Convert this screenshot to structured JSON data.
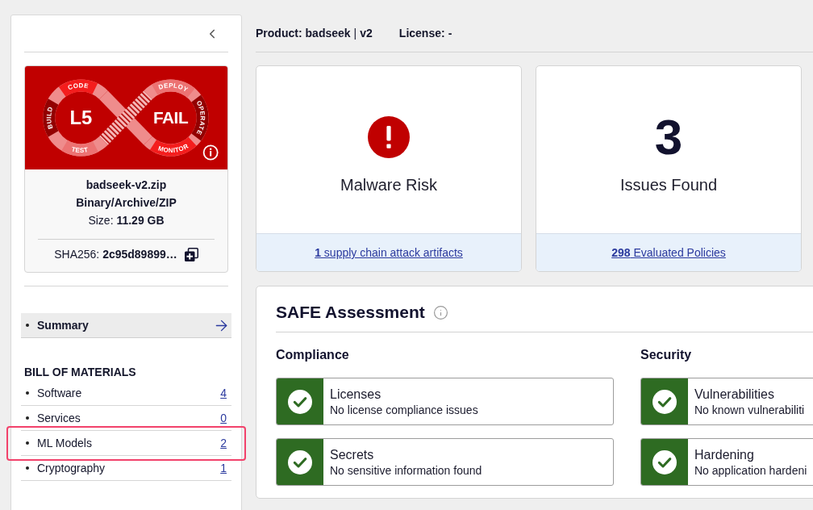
{
  "sidebar": {
    "badge": {
      "grade": "L5",
      "result": "FAIL",
      "stages": [
        {
          "label": "CODE",
          "color": "#f41d1d"
        },
        {
          "label": "DEPLOY",
          "color": "#ec7373"
        },
        {
          "label": "BUILD",
          "color": "#930000"
        },
        {
          "label": "OPERATE",
          "color": "#930000"
        },
        {
          "label": "TEST",
          "color": "#ec7373"
        },
        {
          "label": "MONITOR",
          "color": "#f41d1d"
        }
      ]
    },
    "artifact": {
      "filename": "badseek-v2.zip",
      "type": "Binary/Archive/ZIP",
      "size": "Size: **11.29 GB**",
      "hash": "SHA256: **2c95d89899…**"
    },
    "nav": [
      {
        "label": "Summary",
        "selected": true
      }
    ],
    "bom": {
      "title": "BILL OF MATERIALS",
      "items": [
        {
          "label": "Software",
          "count": "4",
          "highlighted": false
        },
        {
          "label": "Services",
          "count": "0",
          "highlighted": false
        },
        {
          "label": "ML Models",
          "count": "2",
          "highlighted": true
        },
        {
          "label": "Cryptography",
          "count": "1",
          "highlighted": false
        }
      ]
    }
  },
  "header": {
    "product": {
      "label": "Product:",
      "name": "badseek",
      "separator": "|",
      "version": "v2"
    },
    "license": {
      "label": "License:",
      "value": "-"
    }
  },
  "cards": [
    {
      "kind": "alert",
      "title": "Malware Risk",
      "link": "**1** supply chain attack artifacts"
    },
    {
      "kind": "count",
      "value": "3",
      "title": "Issues Found",
      "link": "**298** Evaluated Policies"
    }
  ],
  "assessment": {
    "title": "SAFE Assessment",
    "groups": [
      {
        "title": "Compliance",
        "items": [
          {
            "title": "Licenses",
            "detail": "No license compliance issues",
            "passed": true
          },
          {
            "title": "Secrets",
            "detail": "No sensitive information found",
            "passed": true
          }
        ]
      },
      {
        "title": "Security",
        "items": [
          {
            "title": "Vulnerabilities",
            "detail": "No known vulnerabiliti",
            "passed": true
          },
          {
            "title": "Hardening",
            "detail": "No application hardeni",
            "passed": true
          }
        ]
      }
    ]
  }
}
